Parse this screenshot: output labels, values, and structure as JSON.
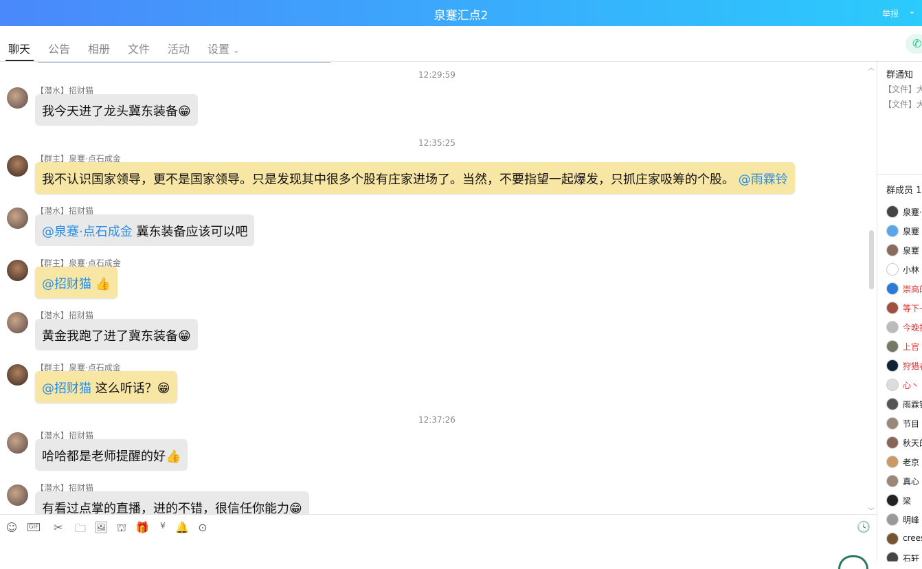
{
  "header": {
    "title": "泉蹇汇点2",
    "report": "举报"
  },
  "tabs": [
    {
      "label": "聊天"
    },
    {
      "label": "公告"
    },
    {
      "label": "相册"
    },
    {
      "label": "文件"
    },
    {
      "label": "活动"
    },
    {
      "label": "设置"
    }
  ],
  "messages": [
    {
      "type": "time",
      "text": "12:29:59"
    },
    {
      "name": "【潜水】招财猫",
      "role": "member",
      "text": "我今天进了龙头冀东装备",
      "emoji": "grin"
    },
    {
      "type": "time",
      "text": "12:35:25"
    },
    {
      "name": "【群主】泉蹇·点石成金",
      "role": "owner",
      "text": "我不认识国家领导，更不是国家领导。只是发现其中很多个股有庄家进场了。当然，不要指望一起爆发，只抓庄家吸筹的个股。",
      "mention": "@雨霖铃"
    },
    {
      "name": "【潜水】招财猫",
      "role": "member",
      "mention": "@泉蹇·点石成金",
      "text": "冀东装备应该可以吧"
    },
    {
      "name": "【群主】泉蹇·点石成金",
      "role": "owner",
      "mention": "@招财猫",
      "emoji": "thumbs-up"
    },
    {
      "name": "【潜水】招财猫",
      "role": "member",
      "text": "黄金我跑了进了冀东装备",
      "emoji": "grin"
    },
    {
      "name": "【群主】泉蹇·点石成金",
      "role": "owner",
      "mention": "@招财猫",
      "text": "这么听话？",
      "emoji": "grin"
    },
    {
      "type": "time",
      "text": "12:37:26"
    },
    {
      "name": "【潜水】招财猫",
      "role": "member",
      "text": "哈哈都是老师提醒的好",
      "emoji": "thumbs-up"
    },
    {
      "name": "【潜水】招财猫",
      "role": "member",
      "text": "有看过点掌的直播，进的不错，很信任你能力",
      "emoji": "grin"
    }
  ],
  "toolbar": [
    "emoji-icon",
    "gif-icon",
    "scissors-icon",
    "folder-icon",
    "image-icon",
    "shop-icon",
    "gift-icon",
    "red-packet-icon",
    "bell-icon",
    "more-icon"
  ],
  "right": {
    "notice_title": "群通知",
    "notices": [
      "【文件】大",
      "【文件】大"
    ],
    "members_title": "群成员 1",
    "members": [
      {
        "name": "泉蹇·",
        "color": "#222"
      },
      {
        "name": "泉蹇",
        "color": "#222"
      },
      {
        "name": "泉蹇",
        "color": "#222"
      },
      {
        "name": "小林",
        "color": "#222"
      },
      {
        "name": "崇高的",
        "color": "#e53030"
      },
      {
        "name": "等下一",
        "color": "#e53030"
      },
      {
        "name": "今晚抄",
        "color": "#e53030"
      },
      {
        "name": "上官",
        "color": "#e53030"
      },
      {
        "name": "狩猎者",
        "color": "#e53030"
      },
      {
        "name": "心丶",
        "color": "#e53030"
      },
      {
        "name": "雨霖铃",
        "color": "#222"
      },
      {
        "name": "节目",
        "color": "#222"
      },
      {
        "name": "秋天的",
        "color": "#222"
      },
      {
        "name": "老京",
        "color": "#222"
      },
      {
        "name": "真心",
        "color": "#222"
      },
      {
        "name": "梁",
        "color": "#222"
      },
      {
        "name": "明峰",
        "color": "#222"
      },
      {
        "name": "crees",
        "color": "#222"
      },
      {
        "name": "石轩",
        "color": "#222"
      }
    ]
  }
}
